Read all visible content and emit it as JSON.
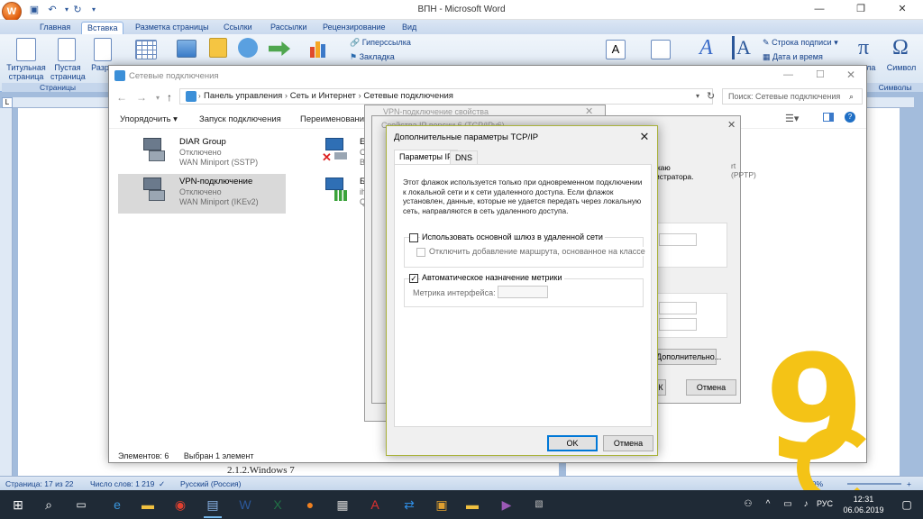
{
  "word": {
    "title": "ВПН - Microsoft Word",
    "office_button": "W",
    "tabs": [
      "Главная",
      "Вставка",
      "Разметка страницы",
      "Ссылки",
      "Рассылки",
      "Рецензирование",
      "Вид"
    ],
    "active_tab": "Вставка",
    "ribbon": {
      "title_page": "Титульная страница",
      "blank_page": "Пустая страница",
      "page_break": "Разр",
      "group_pages": "Страницы",
      "hyperlink": "Гиперссылка",
      "bookmark": "Закладка",
      "signature_line": "Строка подписи",
      "date_time": "Дата и время",
      "formula": "мула",
      "symbol": "Символ",
      "group_symbols": "Символы"
    },
    "doc_text": "2.1.2.Windows 7",
    "status": {
      "page": "Страница: 17 из 22",
      "words": "Число слов: 1 219",
      "language": "Русский (Россия)",
      "zoom": "80%"
    }
  },
  "explorer": {
    "title": "Сетевые подключения",
    "breadcrumb": [
      "Панель управления",
      "Сеть и Интернет",
      "Сетевые подключения"
    ],
    "search_placeholder": "Поиск: Сетевые подключения",
    "toolbar": {
      "organize": "Упорядочить",
      "start_connection": "Запуск подключения",
      "rename": "Переименование"
    },
    "connections": [
      {
        "name": "DIAR Group",
        "status": "Отключено",
        "device": "WAN Miniport (SSTP)"
      },
      {
        "name": "VPN-подключение",
        "status": "Отключено",
        "device": "WAN Miniport (IKEv2)"
      },
      {
        "name": "Ethe",
        "status": "Сете",
        "device": "Broa"
      },
      {
        "name": "Бесп",
        "status": "ihon",
        "device": "Qua"
      }
    ],
    "status_items": "Элементов: 6",
    "status_selected": "Выбран 1 элемент"
  },
  "bg_dialogs": {
    "vpn_props_title": "VPN-подключение свойства",
    "ipv4_title": "Свойства IP версии 6 (TCP/IPv6)",
    "text_fragment_1": "жаю",
    "text_fragment_2": "истратора.",
    "pptp": "rt (PPTP)",
    "advanced_button": "Дополнительно...",
    "ok_partial": "К",
    "cancel_button": "Отмена"
  },
  "dialog": {
    "title": "Дополнительные параметры TCP/IP",
    "close": "✕",
    "tabs": [
      "Параметры IP",
      "DNS"
    ],
    "info": "Этот флажок используется только при одновременном подключении к локальной сети и к сети удаленного доступа. Если флажок установлен, данные, которые не удается передать через локальную сеть, направляются в сеть удаленного доступа.",
    "use_gateway": "Использовать основной шлюз в удаленной сети",
    "disable_route": "Отключить добавление маршрута, основанное на классе",
    "auto_metric": "Автоматическое назначение метрики",
    "metric_label": "Метрика интерфейса:",
    "ok": "OK",
    "cancel": "Отмена"
  },
  "taskbar": {
    "language": "РУС",
    "time": "12:31",
    "date": "06.06.2019"
  },
  "logo": {
    "glyph": "9"
  }
}
